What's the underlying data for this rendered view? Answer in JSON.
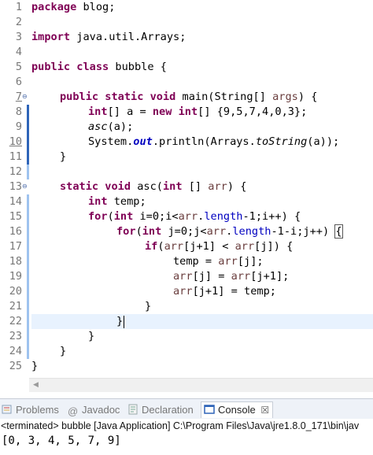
{
  "editor": {
    "line_numbers": [
      "1",
      "2",
      "3",
      "4",
      "5",
      "6",
      "7",
      "8",
      "9",
      "10",
      "11",
      "12",
      "13",
      "14",
      "15",
      "16",
      "17",
      "18",
      "19",
      "20",
      "21",
      "22",
      "23",
      "24",
      "25"
    ],
    "code": {
      "l1_kw": "package",
      "l1_rest": " blog;",
      "l3_kw": "import",
      "l3_rest": " java.util.Arrays;",
      "l5_kw1": "public",
      "l5_kw2": "class",
      "l5_rest": " bubble {",
      "l7_kw1": "public",
      "l7_kw2": "static",
      "l7_kw3": "void",
      "l7_a": " main(String[] ",
      "l7_param": "args",
      "l7_b": ") {",
      "l8_kw1": "int",
      "l8_a": "[] a = ",
      "l8_kw2": "new",
      "l8_kw3": "int",
      "l8_b": "[] {9,5,7,4,0,3};",
      "l9_call": "asc",
      "l9_a": "(a);",
      "l10_a": "System.",
      "l10_out": "out",
      "l10_b": ".println(Arrays.",
      "l10_call": "toString",
      "l10_c": "(a));",
      "l11": "}",
      "l13_kw1": "static",
      "l13_kw2": "void",
      "l13_a": " asc(",
      "l13_kw3": "int",
      "l13_b": " [] ",
      "l13_param": "arr",
      "l13_c": ") {",
      "l14_kw": "int",
      "l14_rest": " temp;",
      "l15_kw1": "for",
      "l15_a": "(",
      "l15_kw2": "int",
      "l15_b": " i=0;i<",
      "l15_arr": "arr",
      "l15_dot": ".",
      "l15_len": "length",
      "l15_c": "-1;i++) {",
      "l16_kw1": "for",
      "l16_a": "(",
      "l16_kw2": "int",
      "l16_b": " j=0;j<",
      "l16_arr": "arr",
      "l16_dot": ".",
      "l16_len": "length",
      "l16_c": "-1-i;j++) ",
      "l16_brace": "{",
      "l17_kw": "if",
      "l17_a": "(",
      "l17_arr1": "arr",
      "l17_b": "[j+1] < ",
      "l17_arr2": "arr",
      "l17_c": "[j]) {",
      "l18_a": "temp = ",
      "l18_arr": "arr",
      "l18_b": "[j];",
      "l19_arr1": "arr",
      "l19_a": "[j] = ",
      "l19_arr2": "arr",
      "l19_b": "[j+1];",
      "l20_arr": "arr",
      "l20_a": "[j+1] = temp;",
      "l21": "}",
      "l22": "}",
      "l23": "}",
      "l24": "}",
      "l25": "}"
    }
  },
  "tabs": [
    {
      "label": "Problems",
      "icon": "problems-icon"
    },
    {
      "label": "Javadoc",
      "icon": "javadoc-icon"
    },
    {
      "label": "Declaration",
      "icon": "declaration-icon"
    },
    {
      "label": "Console",
      "icon": "console-icon",
      "close": "☒"
    }
  ],
  "console": {
    "status": "<terminated> bubble [Java Application] C:\\Program Files\\Java\\jre1.8.0_171\\bin\\jav",
    "output": "[0, 3, 4, 5, 7, 9]"
  },
  "colors": {
    "keyword": "#7f0055",
    "field": "#0000c0",
    "local_var": "#6a3e3e",
    "current_line": "#e8f2fe"
  }
}
